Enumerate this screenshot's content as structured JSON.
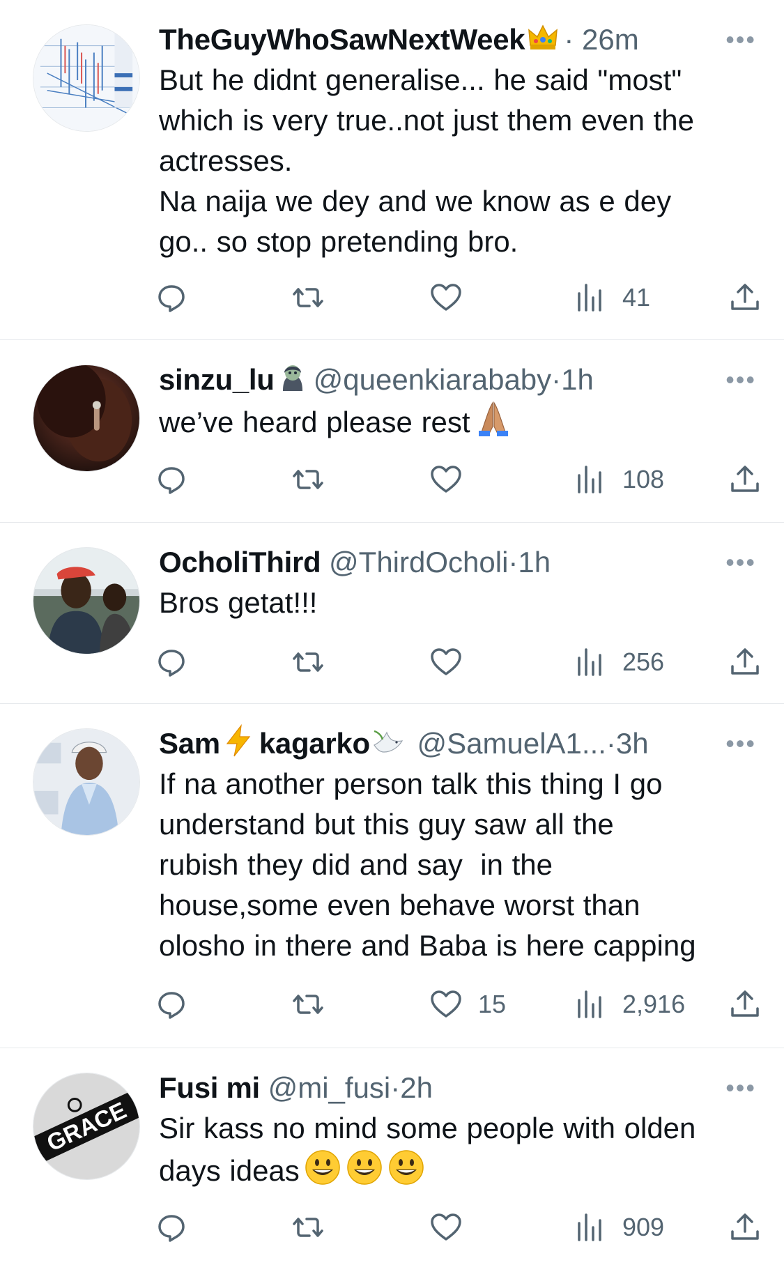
{
  "colors": {
    "text": "#0f1419",
    "secondary": "#536471",
    "divider": "#e6e9ec"
  },
  "tweets": [
    {
      "name": "TheGuyWhoSawNextWeek",
      "name_emoji": "crown-emoji",
      "handle": "",
      "separator": "·",
      "time": "26m",
      "text": "But he didnt generalise... he said \"most\"\nwhich is very true..not just them even the\nactresses.\nNa naija we dey and we know as e dey\ngo.. so stop pretending bro.",
      "likes": "",
      "views": "41",
      "avatar": "chart-avatar"
    },
    {
      "name": "sinzu_lu",
      "name_emoji": "zombie-woman-emoji",
      "handle": "@queenkiarababy",
      "separator": "·",
      "time": "1h",
      "text": "we’ve heard please rest",
      "text_emoji": "folded-hands-emoji",
      "likes": "",
      "views": "108",
      "avatar": "dark-portrait-avatar"
    },
    {
      "name": "OcholiThird",
      "name_emoji": "",
      "handle": "@ThirdOcholi",
      "separator": "·",
      "time": "1h",
      "text": "Bros getat!!!",
      "likes": "",
      "views": "256",
      "avatar": "two-people-avatar"
    },
    {
      "name": "Sam",
      "name_emoji": "lightning-emoji",
      "name_part2": "kagarko",
      "name_emoji2": "dove-emoji",
      "handle": "@SamuelA1...",
      "separator": "·",
      "time": "3h",
      "text": "If na another person talk this thing I go\nunderstand but this guy saw all the\nrubish they did and say  in the\nhouse,some even behave worst than\nolosho in there and Baba is here capping",
      "likes": "15",
      "views": "2,916",
      "avatar": "man-in-cap-avatar"
    },
    {
      "name": "Fusi mi",
      "name_emoji": "",
      "handle": "@mi_fusi",
      "separator": "·",
      "time": "2h",
      "text": "Sir kass no mind some people with olden\ndays ideas",
      "text_emoji": "grinning-face-emoji-x3",
      "likes": "",
      "views": "909",
      "avatar": "grace-logo-avatar",
      "avatar_text": "GRACE"
    }
  ],
  "icons": {
    "more": "•••",
    "reply": "reply-icon",
    "retweet": "retweet-icon",
    "like": "heart-icon",
    "views": "views-icon",
    "share": "share-icon"
  }
}
